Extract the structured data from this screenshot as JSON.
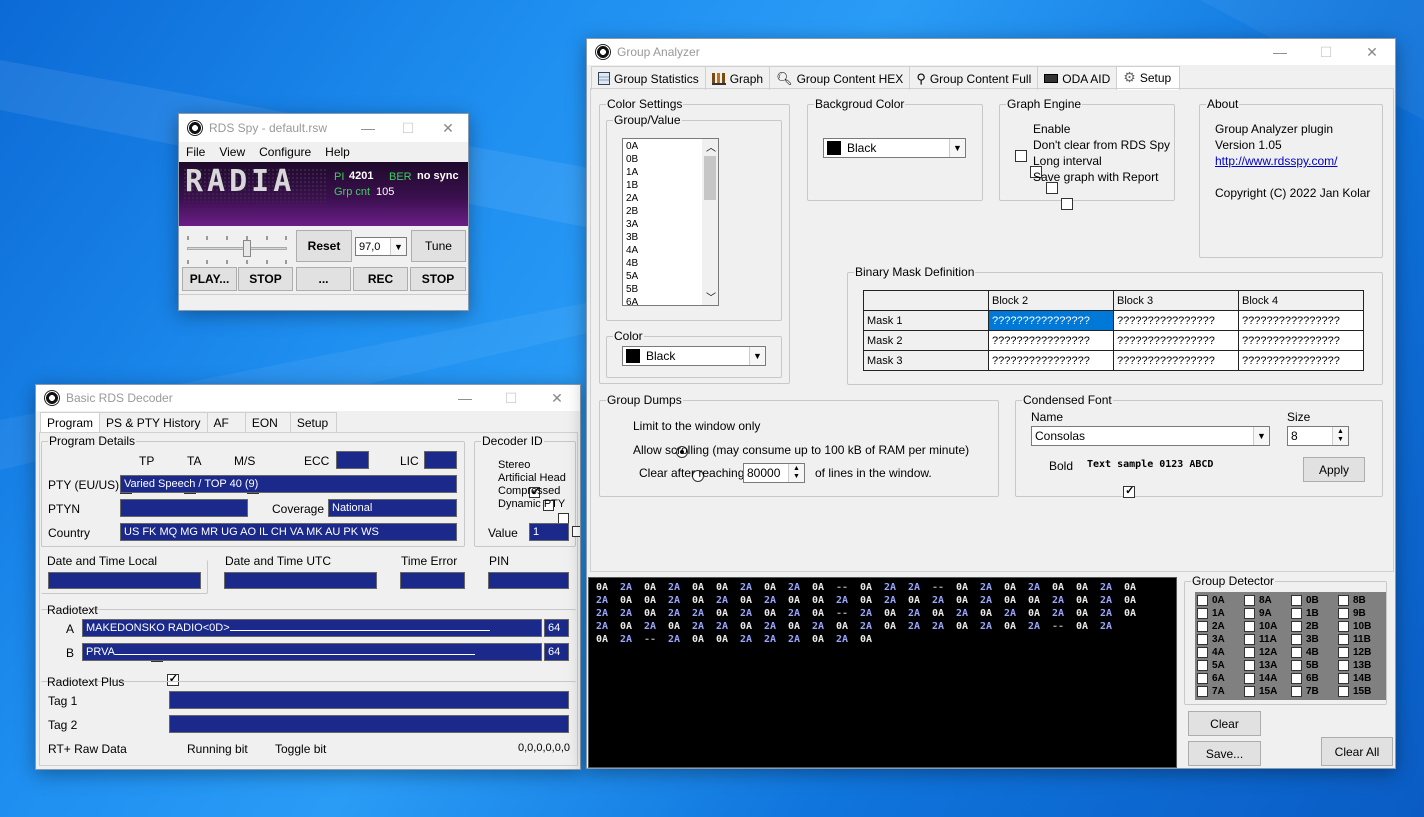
{
  "rds_spy": {
    "title": "RDS Spy - default.rsw",
    "menu": [
      "File",
      "View",
      "Configure",
      "Help"
    ],
    "ps_display": "RADIA",
    "pi_label": "PI",
    "pi_value": "4201",
    "ber_label": "BER",
    "ber_value": "no sync",
    "grp_label": "Grp cnt",
    "grp_value": "105",
    "reset_label": "Reset",
    "frequency": "97,0",
    "tune_label": "Tune",
    "play_label": "PLAY...",
    "stop1_label": "STOP",
    "dots_label": "...",
    "rec_label": "REC",
    "stop2_label": "STOP",
    "slider_level": 0.6
  },
  "decoder": {
    "title": "Basic RDS Decoder",
    "tabs": [
      "Program",
      "PS & PTY History",
      "AF",
      "EON",
      "Setup"
    ],
    "program_details_legend": "Program Details",
    "tp_label": "TP",
    "ta_label": "TA",
    "ms_label": "M/S",
    "ecc_label": "ECC",
    "lic_label": "LIC",
    "pty_label": "PTY (EU/US)",
    "pty_value": "Varied Speech / TOP 40 (9)",
    "ptyn_label": "PTYN",
    "coverage_label": "Coverage",
    "coverage_value": "National",
    "country_label": "Country",
    "country_value": "US FK MQ MG MR UG AO IL CH VA MK AU PK WS",
    "decoder_id_legend": "Decoder ID",
    "stereo_label": "Stereo",
    "artificial_head_label": "Artificial Head",
    "compressed_label": "Compressed",
    "dynamic_pty_label": "Dynamic PTY",
    "value_label": "Value",
    "value_value": "1",
    "dt_local_label": "Date and Time Local",
    "dt_utc_label": "Date and Time UTC",
    "time_error_label": "Time Error",
    "pin_label": "PIN",
    "radiotext_legend": "Radiotext",
    "rt_a_label": "A",
    "rt_a_value": "MAKEDONSKO RADIO<0D>",
    "rt_a_len": "64",
    "rt_b_label": "B",
    "rt_b_value": "PRVA",
    "rt_b_len": "64",
    "rtplus_legend": "Radiotext Plus",
    "tag1_label": "Tag 1",
    "tag2_label": "Tag 2",
    "raw_label": "RT+ Raw Data",
    "running_label": "Running bit",
    "toggle_label": "Toggle bit",
    "raw_value": "0,0,0,0,0,0"
  },
  "analyzer": {
    "title": "Group Analyzer",
    "tabs": [
      {
        "label": "Group Statistics",
        "icon": "statistics-icon"
      },
      {
        "label": "Graph",
        "icon": "graph-icon"
      },
      {
        "label": "Group Content HEX",
        "icon": "magnifier-icon"
      },
      {
        "label": "Group Content Full",
        "icon": "microscope-icon"
      },
      {
        "label": "ODA AID",
        "icon": "chip-icon"
      },
      {
        "label": "Setup",
        "icon": "gear-icon"
      }
    ],
    "color_settings_legend": "Color Settings",
    "group_value_legend": "Group/Value",
    "group_list": [
      "0A",
      "0B",
      "1A",
      "1B",
      "2A",
      "2B",
      "3A",
      "3B",
      "4A",
      "4B",
      "5A",
      "5B",
      "6A"
    ],
    "color_legend": "Color",
    "color_value": "Black",
    "bg_color_legend": "Backgroud Color",
    "bg_color_value": "Black",
    "graph_engine_legend": "Graph Engine",
    "graph_engine_options": [
      "Enable",
      "Don't clear from RDS Spy",
      "Long interval",
      "Save graph with Report"
    ],
    "about_legend": "About",
    "about_line1": "Group Analyzer plugin",
    "about_line2": "Version 1.05",
    "about_link": "http://www.rdsspy.com/",
    "about_copyright": "Copyright (C) 2022 Jan Kolar",
    "mask_legend": "Binary Mask Definition",
    "mask_headers": [
      "Block 2",
      "Block 3",
      "Block 4"
    ],
    "mask_rows": [
      {
        "label": "Mask 1",
        "cells": [
          "????????????????",
          "????????????????",
          "????????????????"
        ]
      },
      {
        "label": "Mask 2",
        "cells": [
          "????????????????",
          "????????????????",
          "????????????????"
        ]
      },
      {
        "label": "Mask 3",
        "cells": [
          "????????????????",
          "????????????????",
          "????????????????"
        ]
      }
    ],
    "dumps_legend": "Group Dumps",
    "dump_opt1": "Limit to the window only",
    "dump_opt2": "Allow scrolling (may consume up to 100 kB of RAM per minute)",
    "clear_after_label": "Clear after reaching",
    "clear_after_value": "80000",
    "clear_after_suffix": "of lines in the window.",
    "font_legend": "Condensed Font",
    "font_name_label": "Name",
    "font_name_value": "Consolas",
    "font_size_label": "Size",
    "font_size_value": "8",
    "bold_label": "Bold",
    "sample_text": "Text sample 0123 ABCD",
    "apply_label": "Apply",
    "dump_lines": [
      "0A 2A 0A 2A 0A 0A 2A 0A 2A 0A -- 0A 2A 2A -- 0A 2A 0A 2A 0A 0A 2A 0A",
      "2A 0A 0A 2A 0A 2A 0A 2A 0A 0A 2A 0A 2A 0A 2A 0A 2A 0A 0A 2A 0A 2A 0A",
      "2A 2A 0A 2A 2A 0A 2A 0A 2A 0A -- 2A 0A 2A 0A 2A 0A 2A 0A 2A 0A 2A 0A",
      "2A 0A 2A 0A 2A 2A 0A 2A 0A 2A 0A 2A 0A 2A 2A 0A 2A 0A 2A -- 0A 2A",
      "0A 2A -- 2A 0A 0A 2A 2A 2A 0A 2A 0A"
    ],
    "detector_legend": "Group Detector",
    "detector_items": [
      [
        "0A",
        "8A",
        "0B",
        "8B"
      ],
      [
        "1A",
        "9A",
        "1B",
        "9B"
      ],
      [
        "2A",
        "10A",
        "2B",
        "10B"
      ],
      [
        "3A",
        "11A",
        "3B",
        "11B"
      ],
      [
        "4A",
        "12A",
        "4B",
        "12B"
      ],
      [
        "5A",
        "13A",
        "5B",
        "13B"
      ],
      [
        "6A",
        "14A",
        "6B",
        "14B"
      ],
      [
        "7A",
        "15A",
        "7B",
        "15B"
      ]
    ],
    "clear_label": "Clear",
    "save_label": "Save...",
    "clear_all_label": "Clear All"
  }
}
